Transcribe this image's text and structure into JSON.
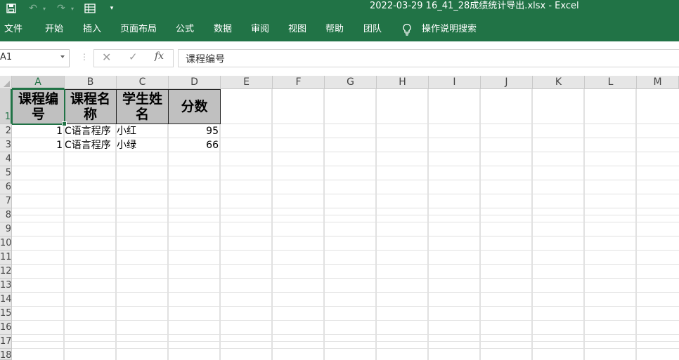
{
  "window": {
    "title": "2022-03-29 16_41_28成绩统计导出.xlsx  -  Excel"
  },
  "quick_access": {
    "save": "save-icon",
    "undo": "undo-icon",
    "redo": "redo-icon",
    "form": "table-icon",
    "customize": "chevron-down-icon"
  },
  "ribbon": {
    "tabs": [
      "文件",
      "开始",
      "插入",
      "页面布局",
      "公式",
      "数据",
      "审阅",
      "视图",
      "帮助",
      "团队"
    ],
    "tell_me": "操作说明搜索"
  },
  "formula_bar": {
    "name_box": "A1",
    "formula": "课程编号",
    "fx": "fx"
  },
  "sheet": {
    "columns": [
      "A",
      "B",
      "C",
      "D",
      "E",
      "F",
      "G",
      "H",
      "I",
      "J",
      "K",
      "L",
      "M"
    ],
    "rows": [
      "1",
      "2",
      "3",
      "4",
      "5",
      "6",
      "7",
      "8",
      "9",
      "10",
      "11",
      "12",
      "13",
      "14",
      "15",
      "16",
      "17",
      "18"
    ],
    "header_row": [
      "课程编号",
      "课程名称",
      "学生姓名",
      "分数"
    ],
    "data": [
      {
        "id": "1",
        "course": "C语言程序",
        "student": "小红",
        "score": "95"
      },
      {
        "id": "1",
        "course": "C语言程序",
        "student": "小绿",
        "score": "66"
      }
    ]
  },
  "colors": {
    "accent": "#217346",
    "header_fill": "#c0c0c0",
    "grid": "#e1e1e1"
  }
}
